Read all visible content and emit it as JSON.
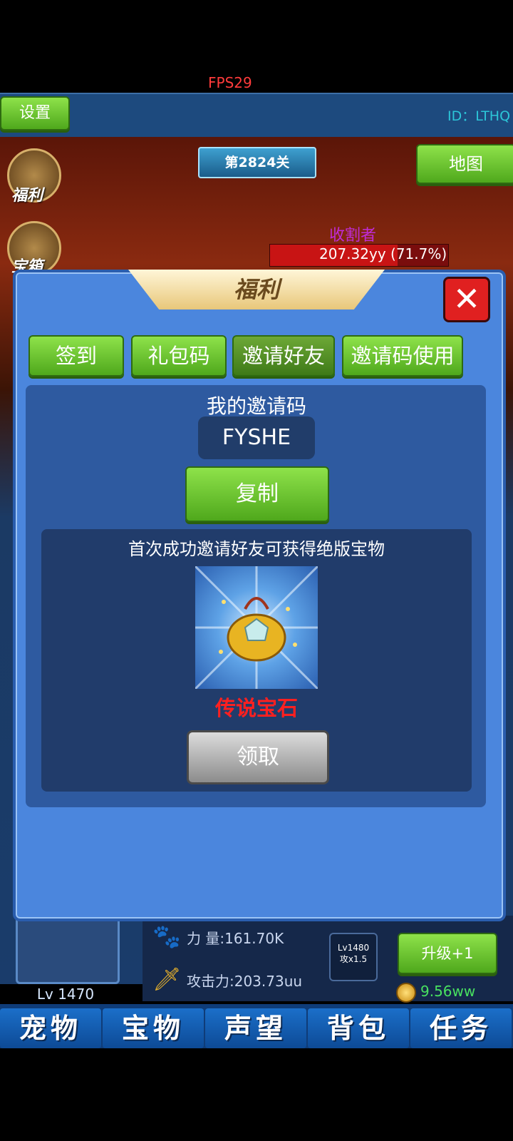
{
  "hud": {
    "fps": "FPS29",
    "settings_label": "设置",
    "id_label": "ID：LTHQ",
    "level_badge": "第2824关",
    "map_label": "地图"
  },
  "side_menu": {
    "welfare_label": "福利",
    "box_label": "宝箱"
  },
  "boss": {
    "name": "收割者",
    "hp_text": "207.32yy (71.7%)",
    "hp_fraction": 0.717
  },
  "dialog": {
    "title": "福利",
    "tabs": [
      "签到",
      "礼包码",
      "邀请好友",
      "邀请码使用"
    ],
    "active_tab": "邀请好友",
    "my_code_label": "我的邀请码",
    "invite_code": "FYSHE",
    "copy_label": "复制",
    "reward_description": "首次成功邀请好友可获得绝版宝物",
    "reward_name": "传说宝石",
    "claim_label": "领取"
  },
  "pet": {
    "level": "Lv 1470"
  },
  "stats": {
    "power": "力 量:161.70K",
    "attack": "攻击力:203.73uu",
    "mini_level": "Lv1480",
    "mini_bonus": "攻x1.5",
    "upgrade_label": "升级+1",
    "coins": "9.56ww"
  },
  "nav": [
    "宠物",
    "宝物",
    "声望",
    "背包",
    "任务"
  ],
  "colors": {
    "accent_green": "#5db322",
    "dialog_blue": "#4b86dd",
    "reward_red": "#ff2020"
  }
}
